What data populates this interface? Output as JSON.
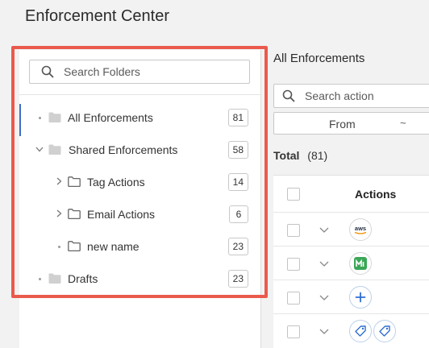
{
  "page": {
    "title": "Enforcement Center"
  },
  "folders": {
    "search_placeholder": "Search Folders",
    "items": [
      {
        "label": "All Enforcements",
        "count": "81",
        "expander": "bullet",
        "indent": 0,
        "selected": true
      },
      {
        "label": "Shared Enforcements",
        "count": "58",
        "expander": "chevron-down",
        "indent": 0,
        "selected": false
      },
      {
        "label": "Tag Actions",
        "count": "14",
        "expander": "chevron-right",
        "indent": 1,
        "selected": false
      },
      {
        "label": "Email Actions",
        "count": "6",
        "expander": "chevron-right",
        "indent": 1,
        "selected": false
      },
      {
        "label": "new name",
        "count": "23",
        "expander": "bullet",
        "indent": 1,
        "selected": false
      },
      {
        "label": "Drafts",
        "count": "23",
        "expander": "bullet",
        "indent": 0,
        "selected": false
      }
    ]
  },
  "main": {
    "title": "All Enforcements",
    "search_placeholder": "Search action",
    "date_from": "From",
    "date_sep": "~",
    "total_label": "Total",
    "total_count": "(81)",
    "table": {
      "header_actions": "Actions",
      "rows": [
        {
          "icon": "aws-icon"
        },
        {
          "icon": "green-app-icon"
        },
        {
          "icon": "plus-icon"
        },
        {
          "icon": "tag-icon"
        }
      ]
    }
  },
  "colors": {
    "highlight": "#ea5a4c",
    "accent": "#3f6fc6",
    "icon_blue": "#2f6fd1",
    "icon_green": "#3aa757"
  }
}
